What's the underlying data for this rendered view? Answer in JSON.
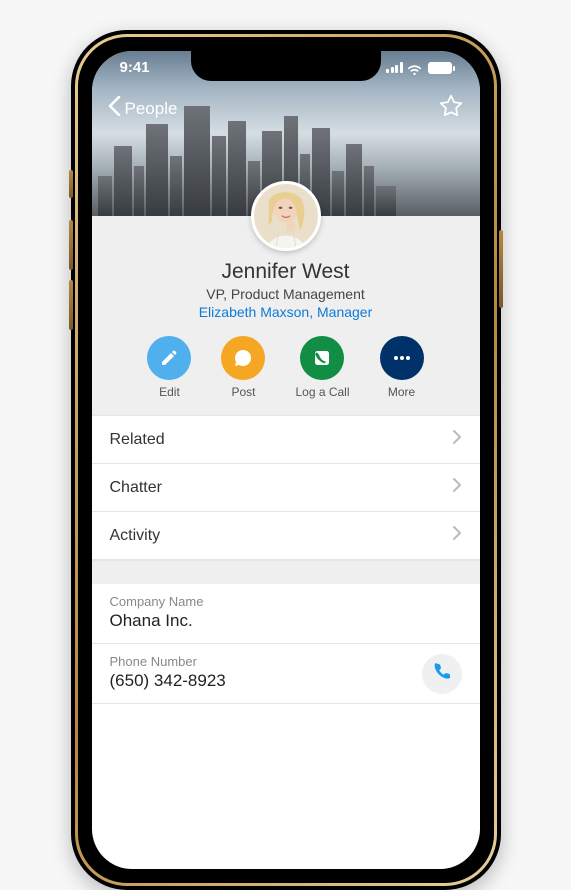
{
  "status": {
    "time": "9:41"
  },
  "nav": {
    "back_label": "People"
  },
  "person": {
    "name": "Jennifer West",
    "title": "VP, Product Management",
    "manager": "Elizabeth Maxson, Manager"
  },
  "actions": {
    "edit": "Edit",
    "post": "Post",
    "log_call": "Log a Call",
    "more": "More"
  },
  "rows": {
    "related": "Related",
    "chatter": "Chatter",
    "activity": "Activity"
  },
  "fields": {
    "company": {
      "label": "Company Name",
      "value": "Ohana Inc."
    },
    "phone": {
      "label": "Phone Number",
      "value": "(650) 342-8923"
    }
  },
  "colors": {
    "link": "#0d7bd6",
    "edit_btn": "#4fb0ed",
    "post_btn": "#f5a623",
    "call_btn": "#128e44",
    "more_btn": "#003269"
  }
}
